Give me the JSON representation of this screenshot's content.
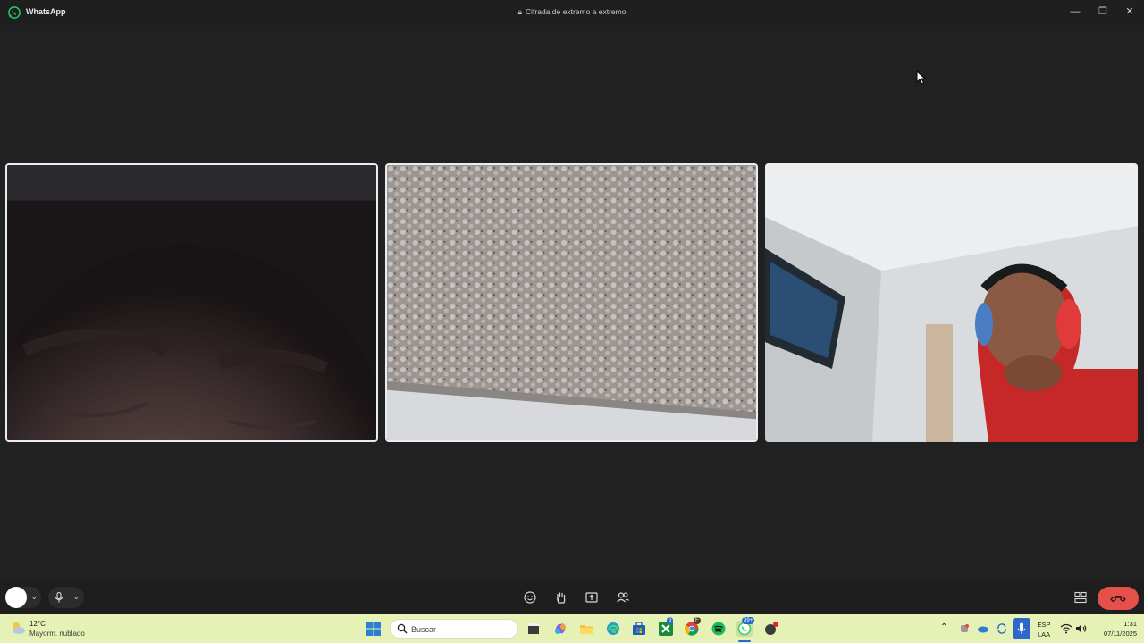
{
  "app": {
    "title": "WhatsApp",
    "encryption_notice": "Cifrada de extremo a extremo",
    "window_buttons": [
      "—",
      "❐",
      "✕"
    ]
  },
  "participants": [
    {
      "id": "p1",
      "selected": true,
      "content": "face-closeup"
    },
    {
      "id": "p2",
      "selected": true,
      "content": "ceiling"
    },
    {
      "id": "p3",
      "selected": false,
      "content": "person-headphones"
    }
  ],
  "call_controls": {
    "camera_chevron": "⌄",
    "mic_chevron": "⌄",
    "center_icons": [
      "emoji-icon",
      "raise-hand-icon",
      "share-screen-icon",
      "add-participant-icon"
    ],
    "right_icons": [
      "layout-grid-icon",
      "end-call-icon"
    ],
    "end_call_color": "#e6504b"
  },
  "taskbar": {
    "weather_temp": "12°C",
    "weather_condition": "Mayorm. nublado",
    "search_placeholder": "Buscar",
    "pinned": [
      "start-icon",
      "file-icon",
      "copilot-icon",
      "explorer-icon",
      "edge-icon",
      "store-icon",
      "xbox-icon",
      "chrome-icon",
      "spotify-icon",
      "whatsapp-icon",
      "app-icon"
    ],
    "badges": {
      "xbox": "3",
      "chrome": "F",
      "whatsapp": "99+"
    },
    "language": "ESP",
    "layout": "LAA",
    "time": "1:31",
    "date": "07/11/2025"
  }
}
